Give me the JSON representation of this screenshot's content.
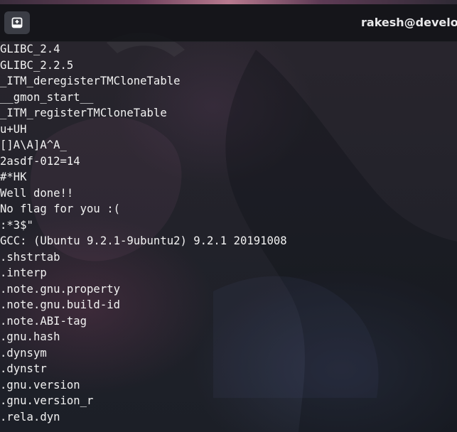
{
  "window": {
    "title": "rakesh@develop",
    "new_tab_icon": "new-tab-icon"
  },
  "terminal": {
    "lines": [
      "GLIBC_2.4",
      "GLIBC_2.2.5",
      "_ITM_deregisterTMCloneTable",
      "__gmon_start__",
      "_ITM_registerTMCloneTable",
      "u+UH",
      "[]A\\A]A^A_",
      "2asdf-012=14",
      "#*HK",
      "Well done!!",
      "No flag for you :(",
      ":*3$\"",
      "GCC: (Ubuntu 9.2.1-9ubuntu2) 9.2.1 20191008",
      ".shstrtab",
      ".interp",
      ".note.gnu.property",
      ".note.gnu.build-id",
      ".note.ABI-tag",
      ".gnu.hash",
      ".dynsym",
      ".dynstr",
      ".gnu.version",
      ".gnu.version_r",
      ".rela.dyn"
    ]
  },
  "colors": {
    "text": "#f2f2f2",
    "titlebar": "#121318",
    "tab_button": "#3b3d45"
  }
}
